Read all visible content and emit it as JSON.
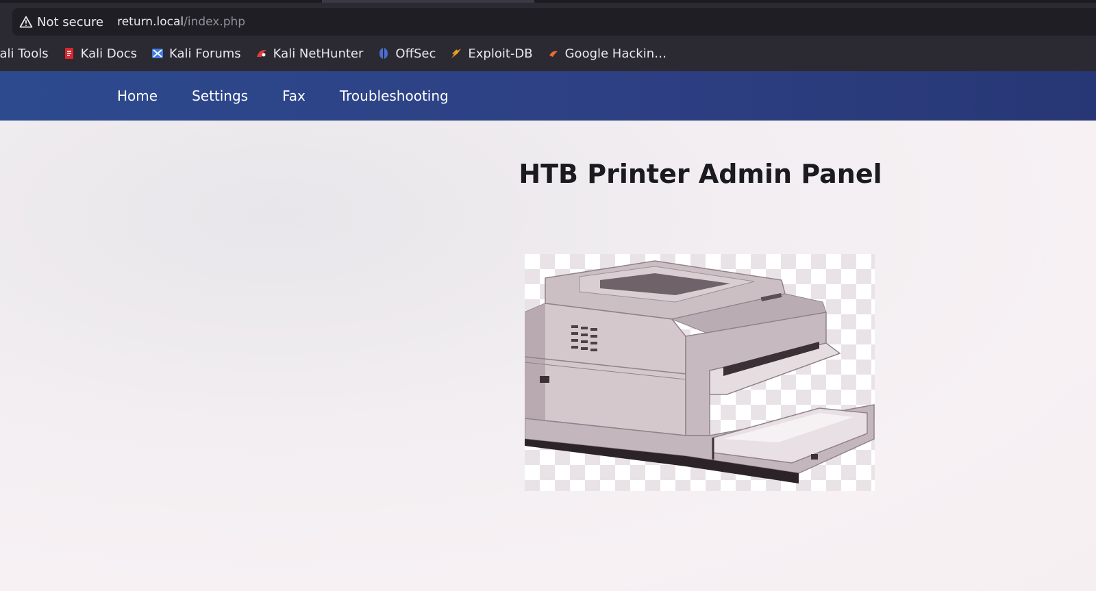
{
  "browser": {
    "security_label": "Not secure",
    "url_host": "return.local",
    "url_path": "/index.php",
    "bookmarks": [
      {
        "label": "Kali Tools",
        "icon": "kali-tools-icon"
      },
      {
        "label": "Kali Docs",
        "icon": "kali-docs-icon"
      },
      {
        "label": "Kali Forums",
        "icon": "kali-forums-icon"
      },
      {
        "label": "Kali NetHunter",
        "icon": "nethunter-icon"
      },
      {
        "label": "OffSec",
        "icon": "offsec-icon"
      },
      {
        "label": "Exploit-DB",
        "icon": "exploit-db-icon"
      },
      {
        "label": "Google Hackin…",
        "icon": "google-hacking-icon"
      }
    ]
  },
  "nav": {
    "items": [
      {
        "label": "Home"
      },
      {
        "label": "Settings"
      },
      {
        "label": "Fax"
      },
      {
        "label": "Troubleshooting"
      }
    ]
  },
  "main": {
    "title": "HTB Printer Admin Panel",
    "image_subject": "printer-image"
  },
  "colors": {
    "nav_bar": "#2d4282",
    "browser_chrome": "#2b2a33",
    "page_background": "#f4eff2"
  }
}
